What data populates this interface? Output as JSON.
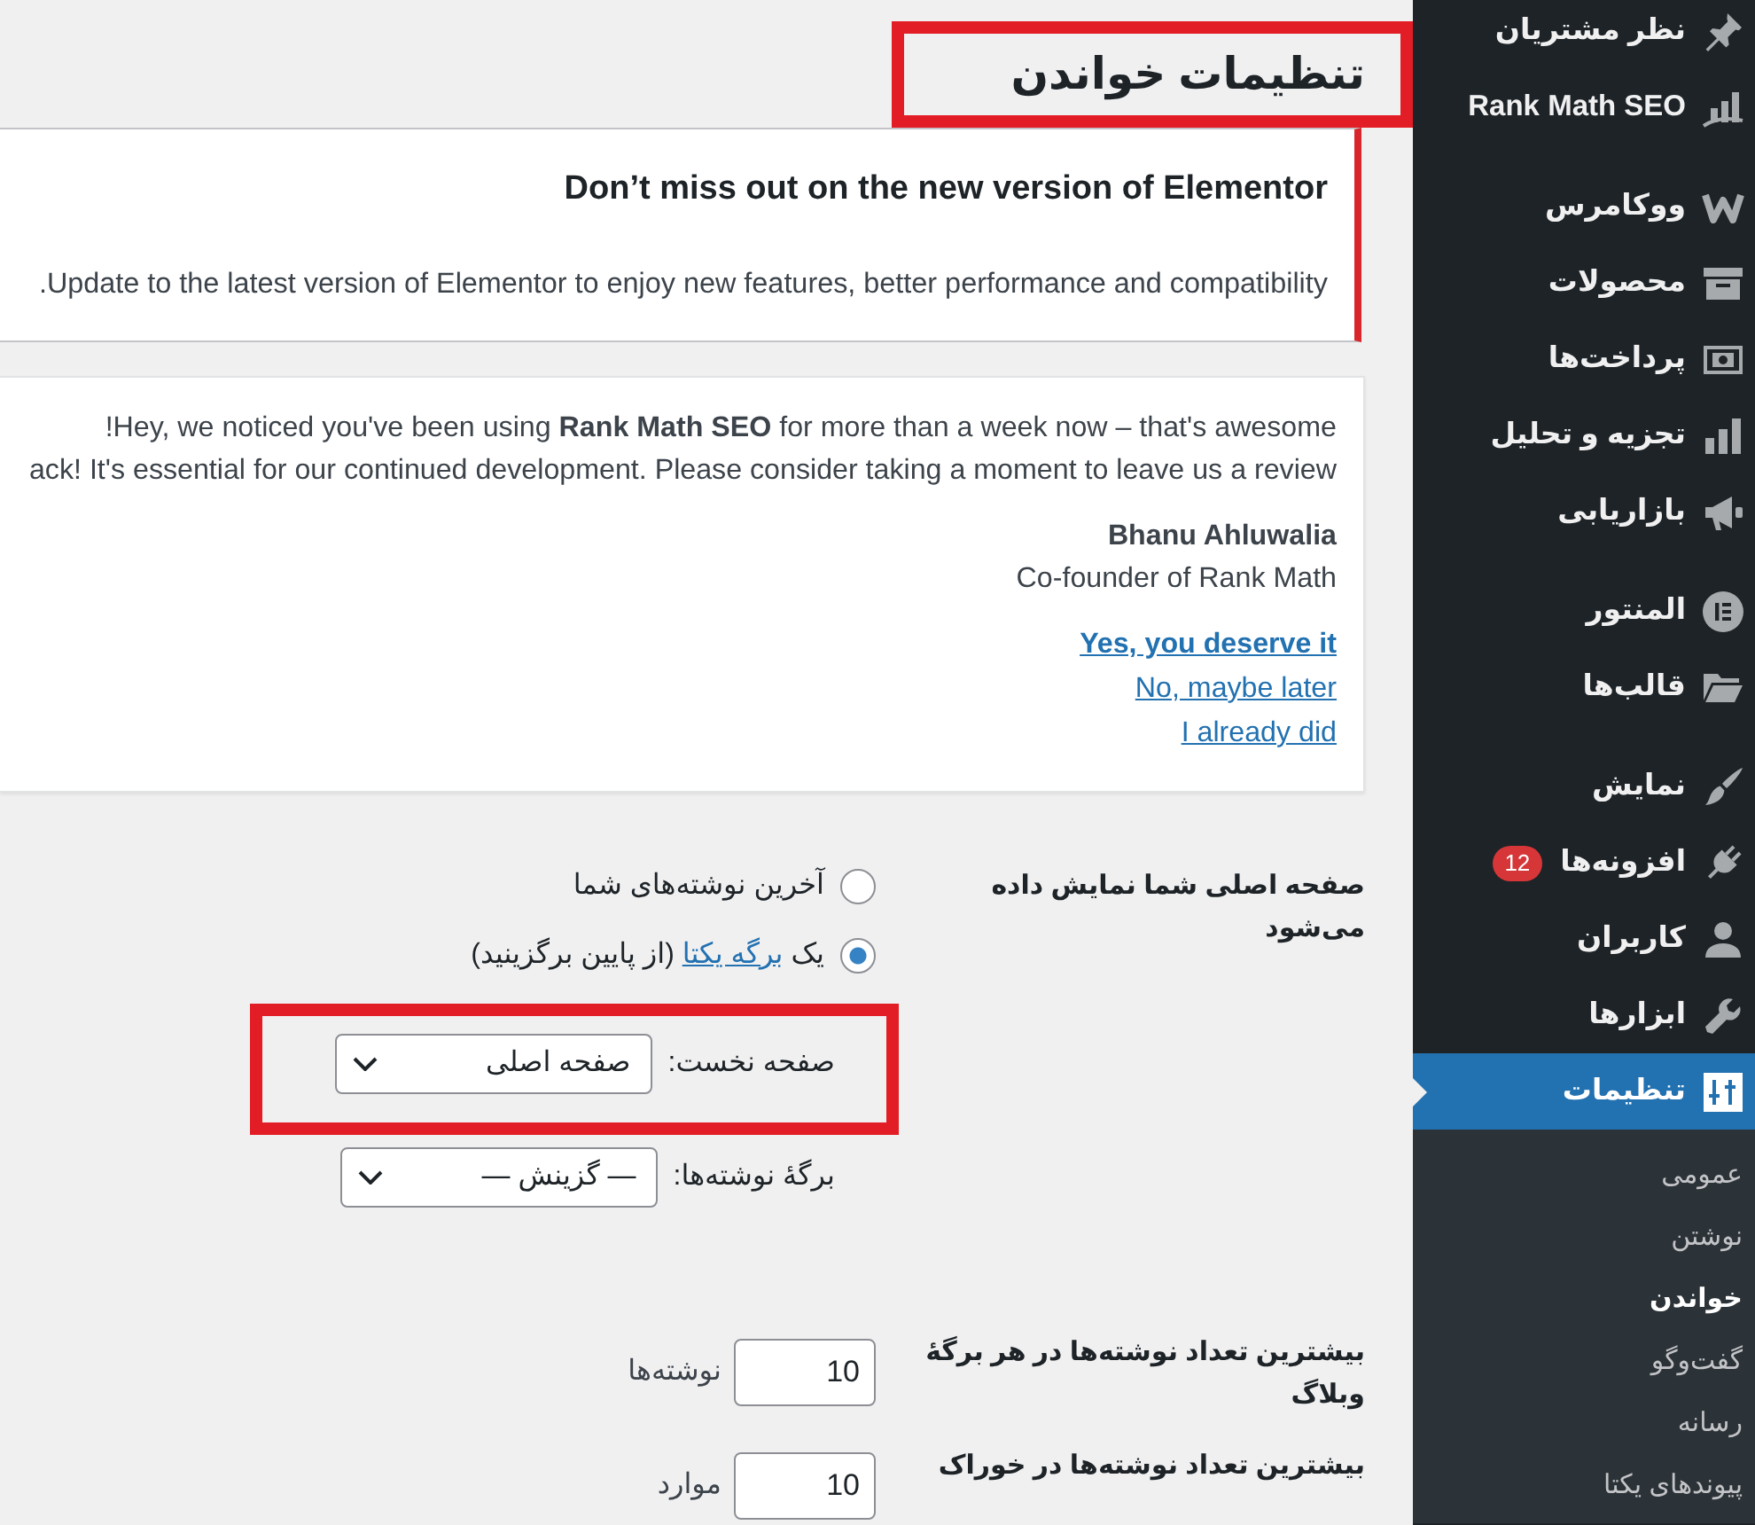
{
  "sidebar": {
    "groups": [
      {
        "items": [
          {
            "label": "نظر مشتریان",
            "selected": false
          },
          {
            "label": "Rank Math SEO",
            "selected": false
          }
        ]
      },
      {
        "items": [
          {
            "label": "ووکامرس",
            "selected": false
          },
          {
            "label": "محصولات",
            "selected": false
          },
          {
            "label": "پرداخت‌ها",
            "selected": false
          },
          {
            "label": "تجزیه و تحلیل",
            "selected": false
          },
          {
            "label": "بازاریابی",
            "selected": false
          }
        ]
      },
      {
        "items": [
          {
            "label": "المنتور",
            "selected": false
          },
          {
            "label": "قالب‌ها",
            "selected": false
          }
        ]
      },
      {
        "items": [
          {
            "label": "نمایش",
            "selected": false
          },
          {
            "label": "افزونه‌ها",
            "selected": false,
            "badge": "12"
          },
          {
            "label": "کاربران",
            "selected": false
          },
          {
            "label": "ابزارها",
            "selected": false
          },
          {
            "label": "تنظیمات",
            "selected": true,
            "children": [
              {
                "label": "عمومی",
                "selected": false
              },
              {
                "label": "نوشتن",
                "selected": false
              },
              {
                "label": "خواندن",
                "selected": true
              },
              {
                "label": "گفت‌وگو",
                "selected": false
              },
              {
                "label": "رسانه",
                "selected": false
              },
              {
                "label": "پیوندهای یکتا",
                "selected": false
              }
            ]
          }
        ]
      }
    ]
  },
  "page_title": {
    "text": "تنظیمات خواندن",
    "highlighted": true
  },
  "elementor_notice": {
    "title": "Don’t miss out on the new version of Elementor",
    "text": ".Update to the latest version of Elementor to enjoy new features, better performance and compatibility"
  },
  "review_notice": {
    "lines": [
      "!Hey, we noticed you've been using **Rank Math SEO** for more than a week now – that's awesome",
      "ack! It's essential for our continued development. Please consider taking a moment to leave us a review"
    ],
    "author": "Bhanu Ahluwalia",
    "role": "Co-founder of Rank Math",
    "links": [
      {
        "text": "Yes, you deserve it",
        "kind": "primary"
      },
      {
        "text": "No, maybe later",
        "kind": "secondary"
      },
      {
        "text": "I already did",
        "kind": "secondary"
      }
    ]
  },
  "settings": {
    "front_page_displays": {
      "label": "صفحه اصلی شما نمایش داده می‌شود",
      "options": [
        {
          "text": "آخرین نوشته‌های شما",
          "selected": false
        },
        {
          "text": "یک",
          "link": "برگه یکتا",
          "after": "(از پایین برگزینید)",
          "selected": true
        }
      ]
    },
    "front_page": {
      "label": "صفحه نخست:",
      "value": "صفحه اصلی",
      "highlighted": true
    },
    "posts_page": {
      "label": "برگهٔ نوشته‌ها:",
      "value": "— گزینش —"
    },
    "number_fields": [
      {
        "label": "بیشترین تعداد نوشته‌ها در هر برگهٔ وبلاگ",
        "value": "10",
        "suffix": "نوشته‌ها"
      },
      {
        "label": "بیشترین تعداد نوشته‌ها در خوراک",
        "value": "10",
        "suffix": "موارد"
      }
    ]
  }
}
